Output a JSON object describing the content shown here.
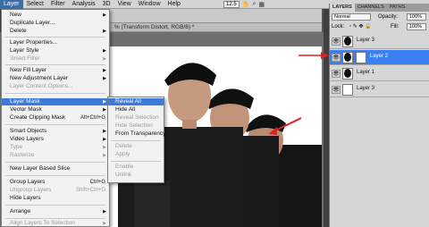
{
  "menubar": {
    "items": [
      "Layer",
      "Select",
      "Filter",
      "Analysis",
      "3D",
      "View",
      "Window",
      "Help"
    ],
    "zoom": "12.5"
  },
  "document_tab": "% (Transform Distort, RGB/8) *",
  "layer_menu": {
    "items": [
      {
        "label": "New",
        "shortcut": "",
        "arrow": true,
        "disabled": false
      },
      {
        "label": "Duplicate Layer...",
        "shortcut": "",
        "arrow": false,
        "disabled": false
      },
      {
        "label": "Delete",
        "shortcut": "",
        "arrow": true,
        "disabled": false
      },
      {
        "label": "Layer Properties...",
        "shortcut": "",
        "arrow": false,
        "disabled": false
      },
      {
        "label": "Layer Style",
        "shortcut": "",
        "arrow": true,
        "disabled": false
      },
      {
        "label": "Smart Filter",
        "shortcut": "",
        "arrow": true,
        "disabled": true
      },
      {
        "label": "New Fill Layer",
        "shortcut": "",
        "arrow": true,
        "disabled": false
      },
      {
        "label": "New Adjustment Layer",
        "shortcut": "",
        "arrow": true,
        "disabled": false
      },
      {
        "label": "Layer Content Options...",
        "shortcut": "",
        "arrow": false,
        "disabled": true
      },
      {
        "label": "Layer Mask",
        "shortcut": "",
        "arrow": true,
        "disabled": false
      },
      {
        "label": "Vector Mask",
        "shortcut": "",
        "arrow": true,
        "disabled": false
      },
      {
        "label": "Create Clipping Mask",
        "shortcut": "Alt+Ctrl+G",
        "arrow": false,
        "disabled": false
      },
      {
        "label": "Smart Objects",
        "shortcut": "",
        "arrow": true,
        "disabled": false
      },
      {
        "label": "Video Layers",
        "shortcut": "",
        "arrow": true,
        "disabled": false
      },
      {
        "label": "Type",
        "shortcut": "",
        "arrow": true,
        "disabled": true
      },
      {
        "label": "Rasterize",
        "shortcut": "",
        "arrow": true,
        "disabled": true
      },
      {
        "label": "New Layer Based Slice",
        "shortcut": "",
        "arrow": false,
        "disabled": false
      },
      {
        "label": "Group Layers",
        "shortcut": "Ctrl+G",
        "arrow": false,
        "disabled": false
      },
      {
        "label": "Ungroup Layers",
        "shortcut": "Shift+Ctrl+G",
        "arrow": false,
        "disabled": true
      },
      {
        "label": "Hide Layers",
        "shortcut": "",
        "arrow": false,
        "disabled": false
      },
      {
        "label": "Arrange",
        "shortcut": "",
        "arrow": true,
        "disabled": false
      },
      {
        "label": "Align Layers To Selection",
        "shortcut": "",
        "arrow": true,
        "disabled": true
      }
    ]
  },
  "layer_mask_submenu": {
    "items": [
      {
        "label": "Reveal All",
        "disabled": false
      },
      {
        "label": "Hide All",
        "disabled": false
      },
      {
        "label": "Reveal Selection",
        "disabled": true
      },
      {
        "label": "Hide Selection",
        "disabled": true
      },
      {
        "label": "From Transparency",
        "disabled": false
      },
      {
        "label": "Delete",
        "disabled": true
      },
      {
        "label": "Apply",
        "disabled": true
      },
      {
        "label": "Enable",
        "disabled": true
      },
      {
        "label": "Unlink",
        "disabled": true
      }
    ]
  },
  "layers_panel": {
    "tabs": [
      "LAYERS",
      "CHANNELS",
      "PATHS"
    ],
    "blend_mode": "Normal",
    "opacity_label": "Opacity:",
    "opacity_value": "100%",
    "lock_label": "Lock:",
    "fill_label": "Fill:",
    "fill_value": "100%",
    "layers": [
      "Layer 3",
      "Layer 2",
      "Layer 1",
      "Layer 3"
    ]
  },
  "colors": {
    "highlight": "#3d7bd8",
    "selected_layer": "#3a80f0",
    "annotation_arrow": "#e02020"
  }
}
